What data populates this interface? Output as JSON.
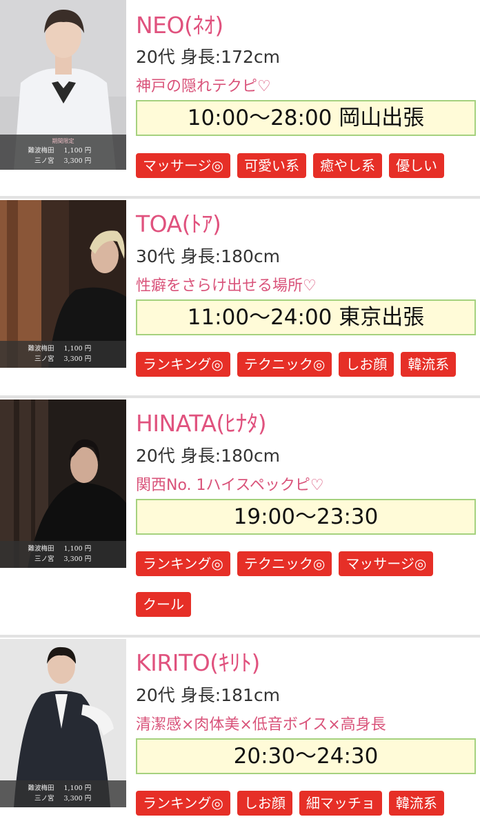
{
  "casts": [
    {
      "name": "NEO(ﾈｵ)",
      "meta": "20代 身長:172cm",
      "catch": "神戸の隠れテクピ♡",
      "schedule": "10:00〜28:00 岡山出張",
      "tags": [
        "マッサージ◎",
        "可愛い系",
        "癒やし系",
        "優しい"
      ],
      "photo": {
        "limited": "期間限定",
        "prices": [
          {
            "area": "難波梅田",
            "amount": "1,100 円"
          },
          {
            "area": "三ノ宮",
            "amount": "3,300 円"
          }
        ]
      }
    },
    {
      "name": "TOA(ﾄｱ)",
      "meta": "30代 身長:180cm",
      "catch": "性癖をさらけ出せる場所♡",
      "schedule": "11:00〜24:00 東京出張",
      "tags": [
        "ランキング◎",
        "テクニック◎",
        "しお顔",
        "韓流系"
      ],
      "photo": {
        "limited": "",
        "prices": [
          {
            "area": "難波梅田",
            "amount": "1,100 円"
          },
          {
            "area": "三ノ宮",
            "amount": "3,300 円"
          }
        ]
      }
    },
    {
      "name": "HINATA(ﾋﾅﾀ)",
      "meta": "20代 身長:180cm",
      "catch": "関西No. 1ハイスペックピ♡",
      "schedule": "19:00〜23:30",
      "tags": [
        "ランキング◎",
        "テクニック◎",
        "マッサージ◎",
        "クール"
      ],
      "photo": {
        "limited": "",
        "prices": [
          {
            "area": "難波梅田",
            "amount": "1,100 円"
          },
          {
            "area": "三ノ宮",
            "amount": "3,300 円"
          }
        ]
      }
    },
    {
      "name": "KIRITO(ｷﾘﾄ)",
      "meta": "20代 身長:181cm",
      "catch": "清潔感×肉体美×低音ボイス×高身長",
      "schedule": "20:30〜24:30",
      "tags": [
        "ランキング◎",
        "しお顔",
        "細マッチョ",
        "韓流系"
      ],
      "photo": {
        "limited": "",
        "prices": [
          {
            "area": "難波梅田",
            "amount": "1,100 円"
          },
          {
            "area": "三ノ宮",
            "amount": "3,300 円"
          }
        ]
      }
    }
  ],
  "colors": {
    "name": "#e0527e",
    "catch": "#d9537a",
    "tag_bg": "#e62f27",
    "schedule_bg": "#fffbd8",
    "schedule_border": "#a5d17e"
  }
}
